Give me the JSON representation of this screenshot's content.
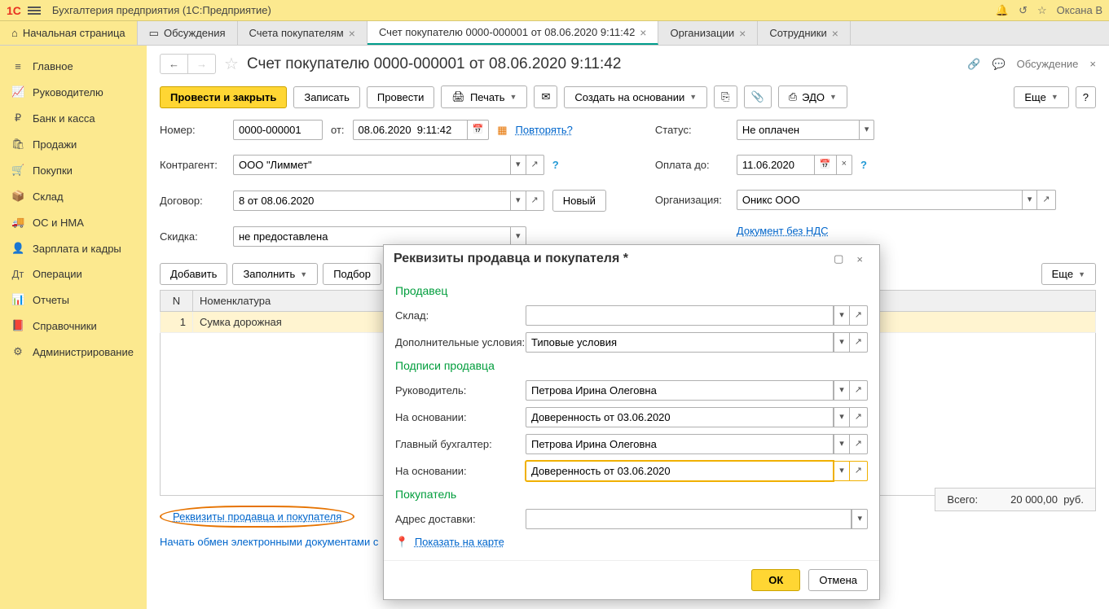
{
  "titleBar": {
    "logo": "1C",
    "appTitle": "Бухгалтерия предприятия  (1С:Предприятие)",
    "userName": "Оксана В"
  },
  "tabs": {
    "home": "Начальная страница",
    "discussions": "Обсуждения",
    "invoices": "Счета покупателям",
    "currentDoc": "Счет покупателю 0000-000001 от 08.06.2020 9:11:42",
    "orgs": "Организации",
    "employees": "Сотрудники"
  },
  "sidebar": {
    "main": "Главное",
    "manager": "Руководителю",
    "bank": "Банк и касса",
    "sales": "Продажи",
    "purchases": "Покупки",
    "warehouse": "Склад",
    "os": "ОС и НМА",
    "salary": "Зарплата и кадры",
    "operations": "Операции",
    "reports": "Отчеты",
    "refs": "Справочники",
    "admin": "Администрирование"
  },
  "doc": {
    "title": "Счет покупателю 0000-000001 от 08.06.2020 9:11:42",
    "discussionLabel": "Обсуждение"
  },
  "toolbar": {
    "postClose": "Провести и закрыть",
    "save": "Записать",
    "post": "Провести",
    "print": "Печать",
    "createBased": "Создать на основании",
    "edo": "ЭДО",
    "more": "Еще"
  },
  "form": {
    "numberLabel": "Номер:",
    "numberValue": "0000-000001",
    "fromLabel": "от:",
    "dateValue": "08.06.2020  9:11:42",
    "repeatLink": "Повторять?",
    "counterpartyLabel": "Контрагент:",
    "counterpartyValue": "ООО \"Лиммет\"",
    "contractLabel": "Договор:",
    "contractValue": "8 от 08.06.2020",
    "newBtn": "Новый",
    "discountLabel": "Скидка:",
    "discountValue": "не предоставлена",
    "statusLabel": "Статус:",
    "statusValue": "Не оплачен",
    "payUntilLabel": "Оплата до:",
    "payUntilValue": "11.06.2020",
    "orgLabel": "Организация:",
    "orgValue": "Оникс ООО",
    "noVatLink": "Документ без НДС"
  },
  "tableToolbar": {
    "add": "Добавить",
    "fill": "Заполнить",
    "select": "Подбор",
    "more": "Еще"
  },
  "table": {
    "colN": "N",
    "colNomenclature": "Номенклатура",
    "row1N": "1",
    "row1Name": "Сумка дорожная"
  },
  "footer": {
    "requisitesLink": "Реквизиты продавца и покупателя",
    "edoStart": "Начать обмен электронными документами с",
    "totalsLabel": "Всего:",
    "totalsValue": "20 000,00",
    "totalsCurrency": "руб."
  },
  "dialog": {
    "title": "Реквизиты продавца и покупателя *",
    "sellerSection": "Продавец",
    "warehouseLabel": "Склад:",
    "warehouseValue": "",
    "extraCondLabel": "Дополнительные условия:",
    "extraCondValue": "Типовые условия",
    "signaturesSection": "Подписи продавца",
    "directorLabel": "Руководитель:",
    "directorValue": "Петрова Ирина Олеговна",
    "basedOn1Label": "На основании:",
    "basedOn1Value": "Доверенность от 03.06.2020",
    "accountantLabel": "Главный бухгалтер:",
    "accountantValue": "Петрова Ирина Олеговна",
    "basedOn2Label": "На основании:",
    "basedOn2Value": "Доверенность от 03.06.2020",
    "buyerSection": "Покупатель",
    "deliveryLabel": "Адрес доставки:",
    "deliveryValue": "",
    "mapLink": "Показать на карте",
    "okBtn": "ОК",
    "cancelBtn": "Отмена"
  }
}
